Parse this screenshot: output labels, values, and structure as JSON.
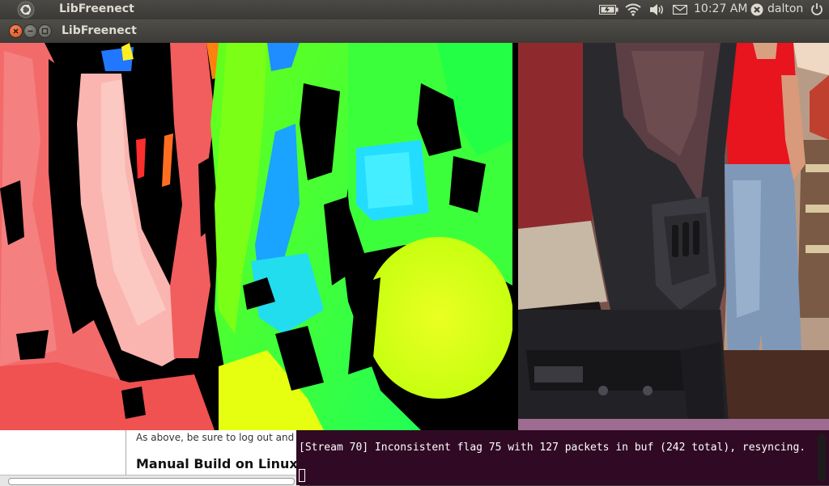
{
  "panel": {
    "app_title": "LibFreenect",
    "clock": "10:27 AM",
    "user": "dalton"
  },
  "window": {
    "title": "LibFreenect"
  },
  "background_doc": {
    "text_line": "As above, be sure to log out and",
    "heading": "Manual Build on Linux"
  },
  "terminal": {
    "output_line": "[Stream 70] Inconsistent flag 75 with 127 packets in buf (242 total), resyncing."
  },
  "colors": {
    "panel_bg": "#3c3b37",
    "close_button": "#df4b17",
    "terminal_bg": "#300a24"
  }
}
